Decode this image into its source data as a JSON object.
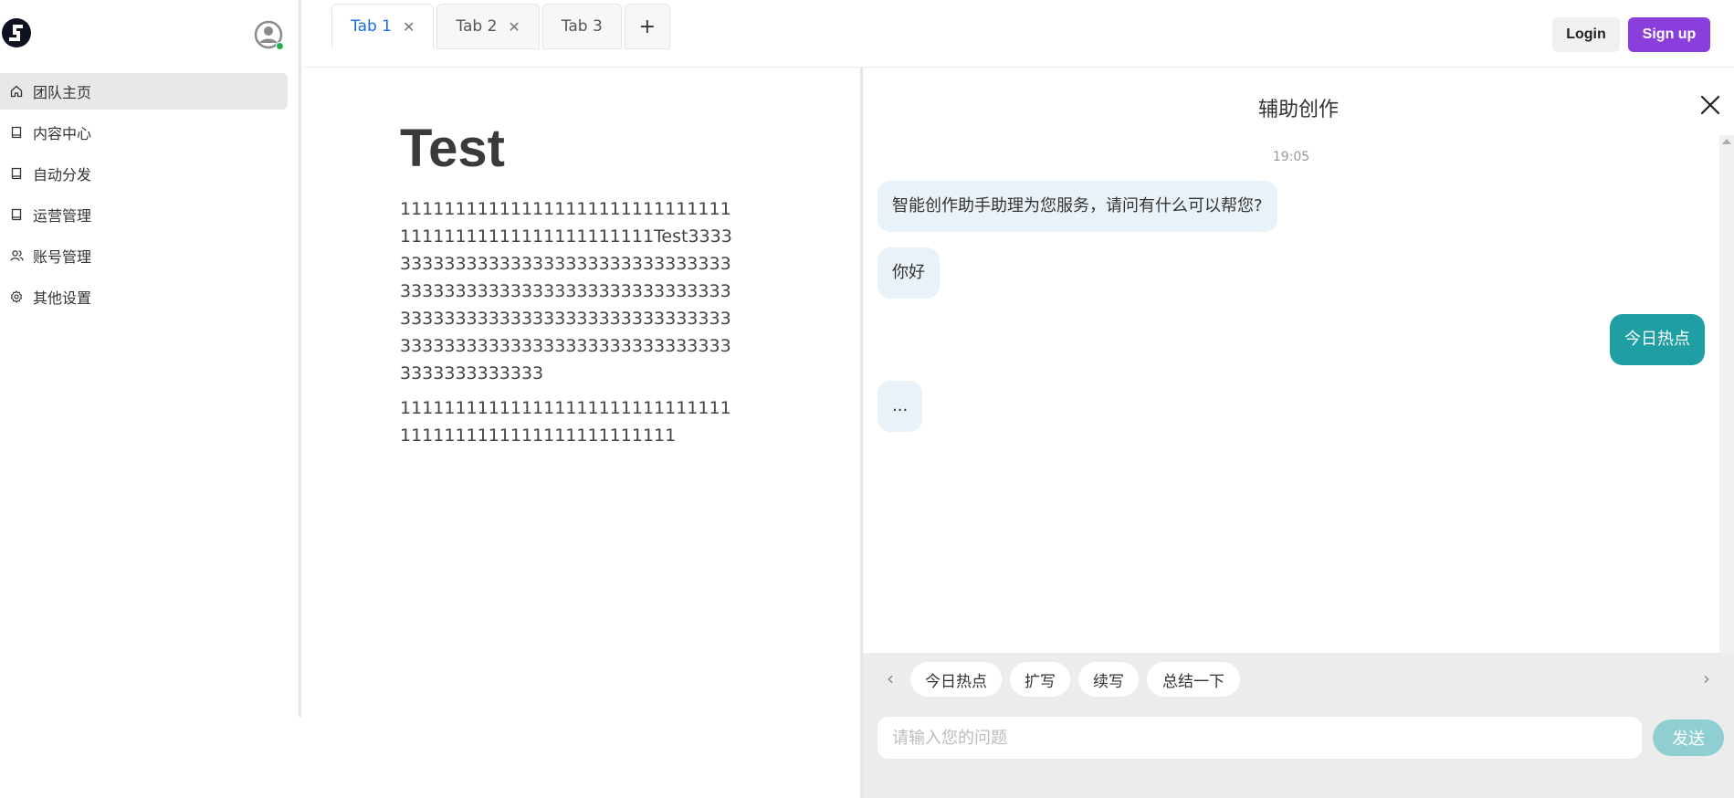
{
  "sidebar": {
    "items": [
      {
        "label": "团队主页",
        "icon": "home-icon",
        "active": true
      },
      {
        "label": "内容中心",
        "icon": "book-icon"
      },
      {
        "label": "自动分发",
        "icon": "book-icon"
      },
      {
        "label": "运营管理",
        "icon": "book-icon"
      },
      {
        "label": "账号管理",
        "icon": "users-icon"
      },
      {
        "label": "其他设置",
        "icon": "gear-icon"
      }
    ]
  },
  "tabs": [
    {
      "label": "Tab 1",
      "closable": true,
      "active": true
    },
    {
      "label": "Tab 2",
      "closable": true
    },
    {
      "label": "Tab 3",
      "closable": false
    }
  ],
  "header": {
    "add_tab": "+",
    "login_label": "Login",
    "signup_label": "Sign up"
  },
  "document": {
    "title": "Test",
    "paragraphs": [
      "11111111111111111111111111111111111111111111111111111Test33333333333333333333333333333333333333333333333333333333333333333333333333333333333333333333333333333333333333333333333333333333333333333",
      "1111111111111111111111111111111111111111111111111111111"
    ]
  },
  "assistant": {
    "title": "辅助创作",
    "timestamp": "19:05",
    "messages": [
      {
        "role": "bot",
        "text": "智能创作助手助理为您服务，请问有什么可以帮您?"
      },
      {
        "role": "bot",
        "text": "你好"
      },
      {
        "role": "user",
        "text": "今日热点"
      },
      {
        "role": "bot",
        "text": "..."
      }
    ],
    "chips": [
      "今日热点",
      "扩写",
      "续写",
      "总结一下"
    ],
    "input_placeholder": "请输入您的问题",
    "send_label": "发送"
  },
  "colors": {
    "accent_purple": "#8a3fdc",
    "user_bubble": "#1f9ea3",
    "bot_bubble": "#e9f2f8",
    "active_tab": "#1a6fe0",
    "online_dot": "#22b14c"
  }
}
